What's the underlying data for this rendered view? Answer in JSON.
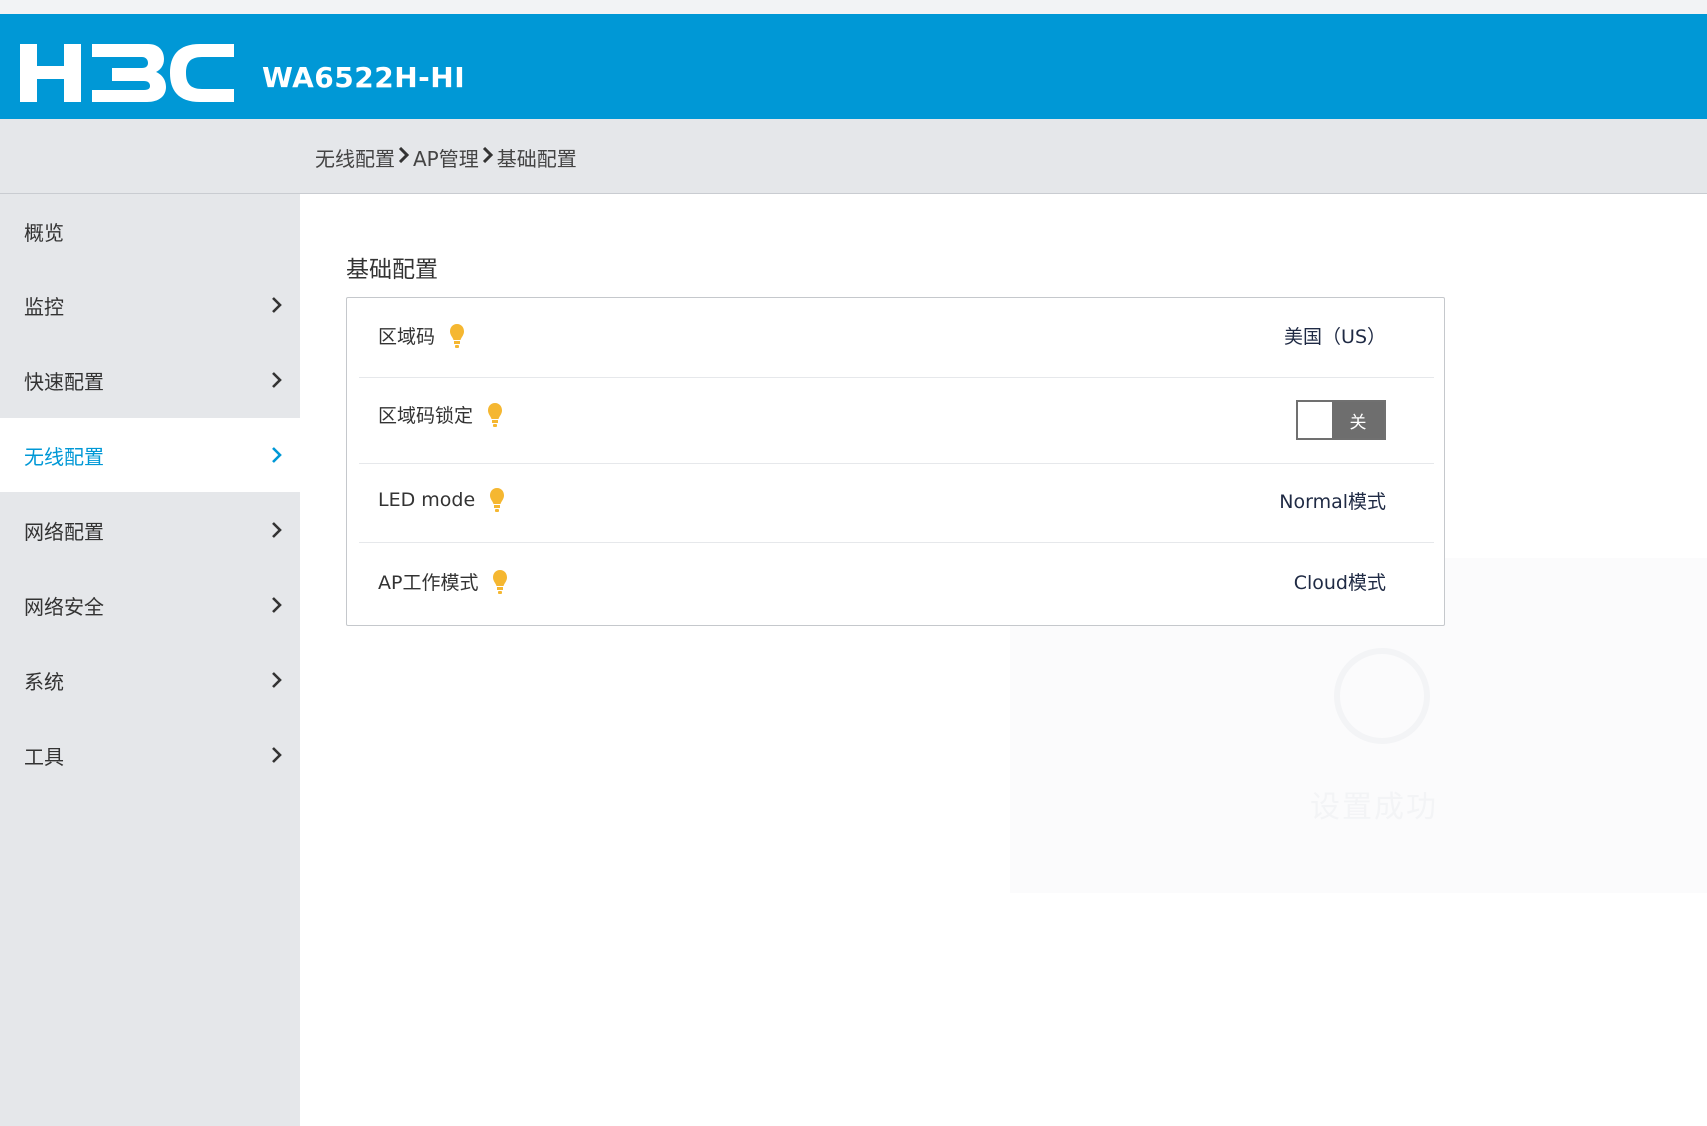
{
  "header": {
    "brand": "H3C",
    "model": "WA6522H-HI",
    "brand_color": "#0098d6"
  },
  "breadcrumb": {
    "items": [
      "无线配置",
      "AP管理",
      "基础配置"
    ]
  },
  "sidebar": {
    "items": [
      {
        "label": "概览",
        "has_arrow": false,
        "active": false
      },
      {
        "label": "监控",
        "has_arrow": true,
        "active": false
      },
      {
        "label": "快速配置",
        "has_arrow": true,
        "active": false
      },
      {
        "label": "无线配置",
        "has_arrow": true,
        "active": true
      },
      {
        "label": "网络配置",
        "has_arrow": true,
        "active": false
      },
      {
        "label": "网络安全",
        "has_arrow": true,
        "active": false
      },
      {
        "label": "系统",
        "has_arrow": true,
        "active": false
      },
      {
        "label": "工具",
        "has_arrow": true,
        "active": false
      }
    ]
  },
  "main": {
    "title": "基础配置",
    "rows": [
      {
        "label": "区域码",
        "value": "美国（US）",
        "icon": "lightbulb-icon"
      },
      {
        "label": "区域码锁定",
        "toggle_text": "关",
        "toggle_on": false,
        "icon": "lightbulb-icon"
      },
      {
        "label": "LED mode",
        "value": "Normal模式",
        "icon": "lightbulb-icon"
      },
      {
        "label": "AP工作模式",
        "value": "Cloud模式",
        "icon": "lightbulb-icon"
      }
    ]
  },
  "empty_state": {
    "text": "设置成功"
  }
}
